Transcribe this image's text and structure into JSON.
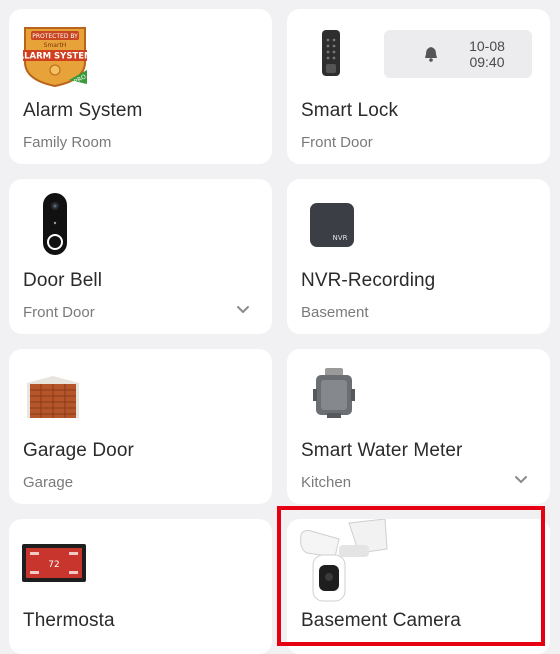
{
  "devices": [
    {
      "name": "Alarm System",
      "location": "Family Room",
      "icon": "alarm-system-badge-icon",
      "badge_top": "PROTECTED BY",
      "badge_brand": "SmartH",
      "badge_main": "ALARM SYSTEM",
      "badge_tag": "PRO"
    },
    {
      "name": "Smart Lock",
      "location": "Front Door",
      "icon": "smart-lock-icon",
      "notice_date": "10-08",
      "notice_time": "09:40",
      "notice_icon": "bell-icon"
    },
    {
      "name": "Door Bell",
      "location": "Front Door",
      "icon": "doorbell-icon",
      "expand_icon": "chevron-down-icon"
    },
    {
      "name": "NVR-Recording",
      "location": "Basement",
      "icon": "nvr-icon",
      "icon_label": "NVR"
    },
    {
      "name": "Garage Door",
      "location": "Garage",
      "icon": "garage-door-icon"
    },
    {
      "name": "Smart Water Meter",
      "location": "Kitchen",
      "icon": "water-meter-icon",
      "expand_icon": "chevron-down-icon"
    },
    {
      "name": "Thermosta",
      "location": "",
      "icon": "thermostat-icon",
      "icon_label": "72"
    },
    {
      "name": "Basement Camera",
      "location": "",
      "icon": "floodlight-camera-icon",
      "highlighted": true
    }
  ],
  "colors": {
    "background": "#f1f1f3",
    "card": "#ffffff",
    "highlight": "#e60012"
  }
}
